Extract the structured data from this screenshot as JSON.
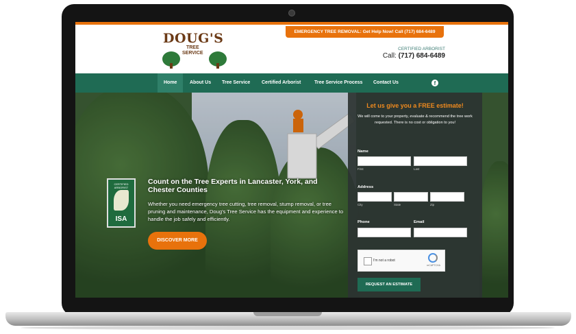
{
  "header": {
    "emergency_banner": "EMERGENCY TREE REMOVAL: Get Help Now! Call (717) 684-6489",
    "logo_title": "DOUG'S",
    "logo_sub_line1": "TREE",
    "logo_sub_line2": "SERVICE",
    "certified_label": "CERTIFIED ARBORIST",
    "call_prefix": "Call:",
    "call_number": "(717) 684-6489"
  },
  "nav": {
    "items": [
      "Home",
      "About Us",
      "Tree Service",
      "Certified Arborist",
      "Tree Service Process",
      "Contact Us"
    ],
    "facebook_icon": "f"
  },
  "hero": {
    "badge_top": "CERTIFIED ARBORIST",
    "badge_bottom": "ISA",
    "heading": "Count on the Tree Experts in Lancaster, York, and Chester Counties",
    "body": "Whether you need emergency tree cutting, tree removal, stump removal, or tree pruning and maintenance, Doug's Tree Service has the equipment and experience to handle the job safely and efficiently.",
    "cta": "DISCOVER MORE"
  },
  "form": {
    "title": "Let us give you a FREE estimate!",
    "description": "We will come to your property, evaluate & recommend the tree work requested. There is no cost or obligation to you!",
    "name_label": "Name",
    "first_sub": "First",
    "last_sub": "Last",
    "address_label": "Address",
    "city_sub": "City",
    "state_sub": "State",
    "zip_sub": "Zip",
    "phone_label": "Phone",
    "email_label": "Email",
    "captcha_text": "I'm not a robot",
    "captcha_brand": "reCAPTCHA",
    "submit": "REQUEST AN ESTIMATE"
  },
  "colors": {
    "accent_orange": "#e8720c",
    "nav_green": "#1f6b54",
    "brand_brown": "#6b3a16"
  }
}
